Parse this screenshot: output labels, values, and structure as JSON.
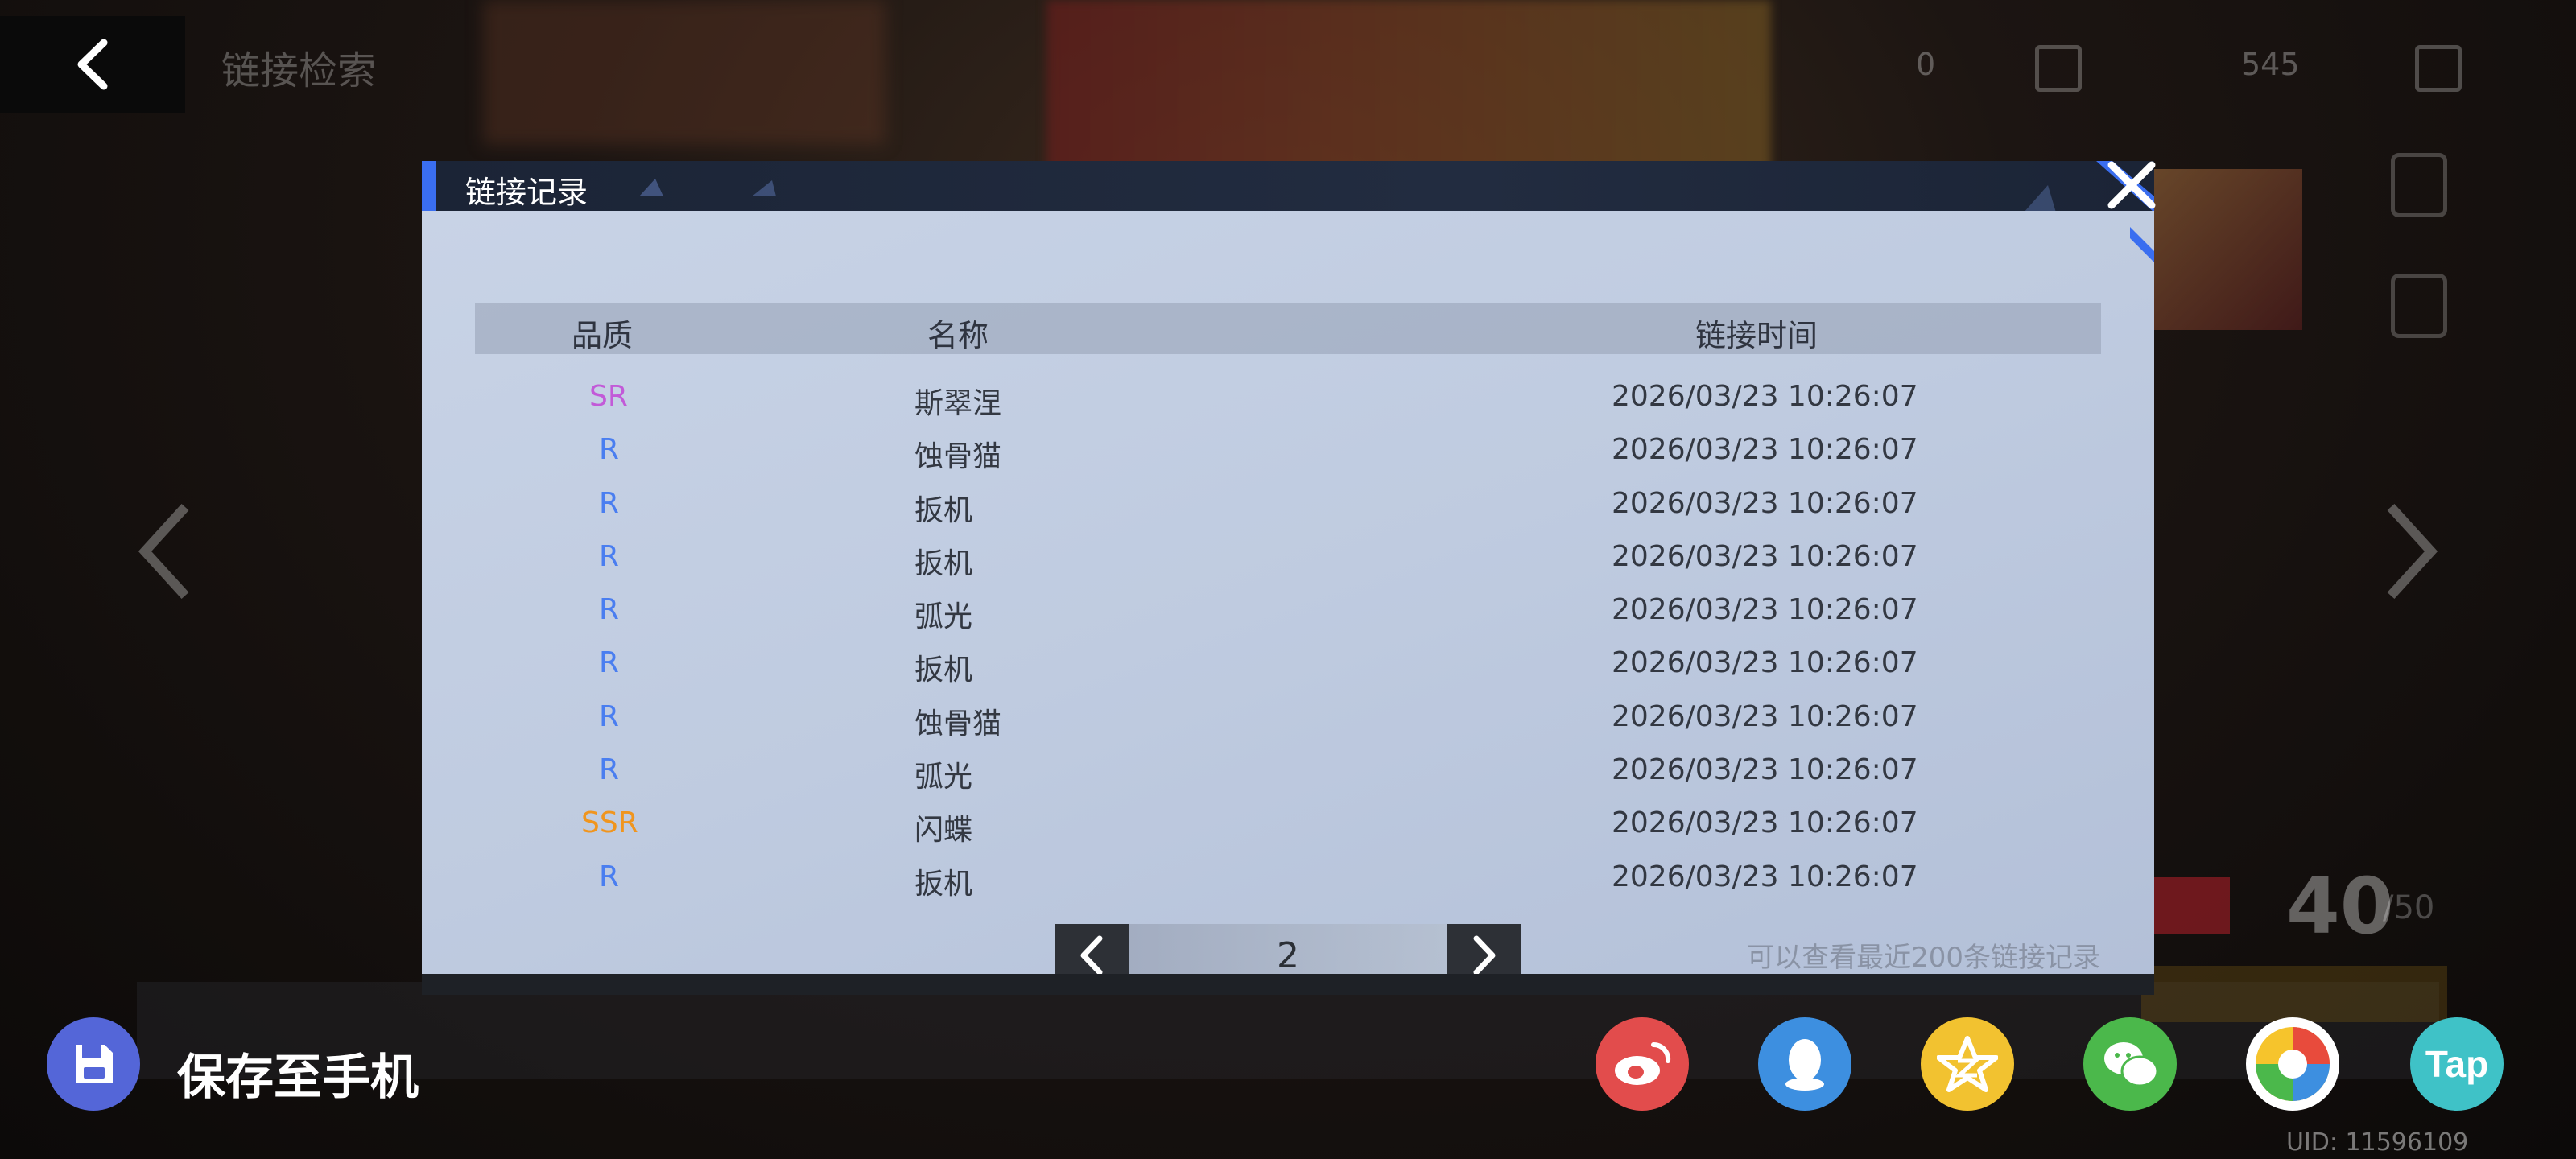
{
  "background": {
    "screen_title": "链接检索",
    "top_counter_1": "0",
    "top_counter_2": "545",
    "big_number": "40",
    "small_number": "/50"
  },
  "dialog": {
    "title": "链接记录",
    "columns": [
      "品质",
      "名称",
      "链接时间"
    ],
    "rows": [
      {
        "quality": "SR",
        "name": "斯翠涅",
        "time": "2026/03/23 10:26:07"
      },
      {
        "quality": "R",
        "name": "蚀骨猫",
        "time": "2026/03/23 10:26:07"
      },
      {
        "quality": "R",
        "name": "扳机",
        "time": "2026/03/23 10:26:07"
      },
      {
        "quality": "R",
        "name": "扳机",
        "time": "2026/03/23 10:26:07"
      },
      {
        "quality": "R",
        "name": "弧光",
        "time": "2026/03/23 10:26:07"
      },
      {
        "quality": "R",
        "name": "扳机",
        "time": "2026/03/23 10:26:07"
      },
      {
        "quality": "R",
        "name": "蚀骨猫",
        "time": "2026/03/23 10:26:07"
      },
      {
        "quality": "R",
        "name": "弧光",
        "time": "2026/03/23 10:26:07"
      },
      {
        "quality": "SSR",
        "name": "闪蝶",
        "time": "2026/03/23 10:26:07"
      },
      {
        "quality": "R",
        "name": "扳机",
        "time": "2026/03/23 10:26:07"
      }
    ],
    "page": "2",
    "hint": "可以查看最近200条链接记录"
  },
  "colors": {
    "R": "#4a7ef0",
    "SR": "#c25ad8",
    "SSR": "#f0951e",
    "accent": "#3a6ef0"
  },
  "bottom": {
    "save_label": "保存至手机",
    "share_targets": [
      {
        "name": "weibo-icon",
        "color": "#e24c4c"
      },
      {
        "name": "qq-icon",
        "color": "#3d8fe0"
      },
      {
        "name": "qzone-icon",
        "color": "#f2c230"
      },
      {
        "name": "wechat-icon",
        "color": "#4bb84b"
      },
      {
        "name": "photos-icon",
        "color": "#ffffff"
      },
      {
        "name": "taptap-icon",
        "color": "#3fc2c7"
      }
    ],
    "taptap_text": "Tap",
    "uid": "UID:  11596109"
  }
}
